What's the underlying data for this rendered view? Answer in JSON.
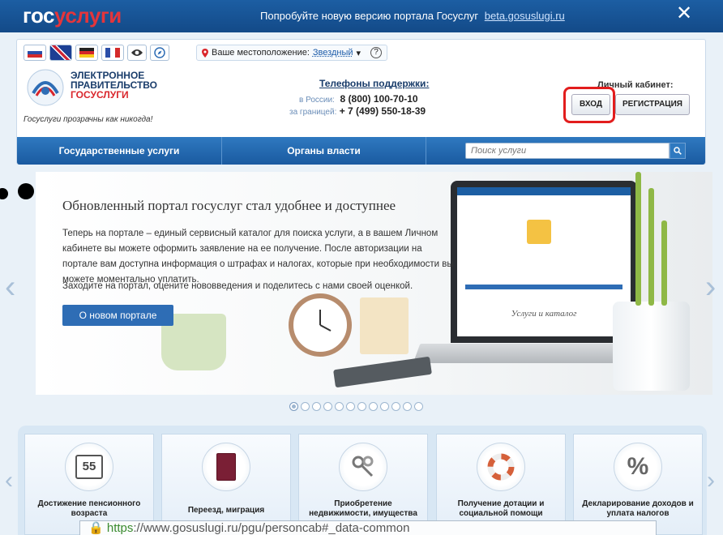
{
  "banner": {
    "logo_a": "гос",
    "logo_b": "услуги",
    "message": "Попробуйте новую версию портала Госуслуг",
    "link": "beta.gosuslugi.ru",
    "close": "✕"
  },
  "header": {
    "location_label": "Ваше местоположение:",
    "location_city": "Звездный",
    "location_caret": "▾",
    "help": "?",
    "egov_line1": "ЭЛЕКТРОННОЕ",
    "egov_line2": "ПРАВИТЕЛЬСТВО",
    "egov_line3": "ГОСУСЛУГИ",
    "tagline": "Госуслуги прозрачны как никогда!",
    "support_title": "Телефоны поддержки:",
    "russia_label": "в России:",
    "russia_phone": "8 (800) 100-70-10",
    "abroad_label": "за границей:",
    "abroad_phone": "+ 7 (499) 550-18-39",
    "cabinet_label": "Личный кабинет:",
    "login": "ВХОД",
    "register": "РЕГИСТРАЦИЯ"
  },
  "nav": {
    "services": "Государственные услуги",
    "authorities": "Органы власти",
    "search_placeholder": "Поиск услуги"
  },
  "slide": {
    "title": "Обновленный портал госуслуг стал удобнее и доступнее",
    "text": "Теперь на портале – единый сервисный каталог для поиска услуги, а в вашем Личном кабинете вы можете оформить заявление на ее получение. После авторизации на портале вам доступна информация о штрафах и налогах, которые при необходимости вы можете моментально уплатить.",
    "text2": "Заходите на портал, оцените нововведения и поделитесь с нами своей оценкой.",
    "button": "О новом портале",
    "screen_caption": "Услуги и каталог"
  },
  "pager": {
    "total": 12,
    "active": 1
  },
  "tiles": [
    {
      "label": "Достижение пенсионного возраста",
      "icon": "55"
    },
    {
      "label": "Переезд, миграция",
      "icon": "passport-icon"
    },
    {
      "label": "Приобретение недвижимости, имущества",
      "icon": "keys-icon"
    },
    {
      "label": "Получение дотации и социальной помощи",
      "icon": "lifebuoy-icon"
    },
    {
      "label": "Декларирование доходов и уплата налогов",
      "icon": "%"
    }
  ],
  "statusbar": {
    "scheme": "https",
    "rest": "://www.gosuslugi.ru/pgu/personcab#_data-common"
  },
  "colors": {
    "brand_blue": "#1c5ea3",
    "brand_red": "#e4353b",
    "highlight": "#e21d1d"
  }
}
